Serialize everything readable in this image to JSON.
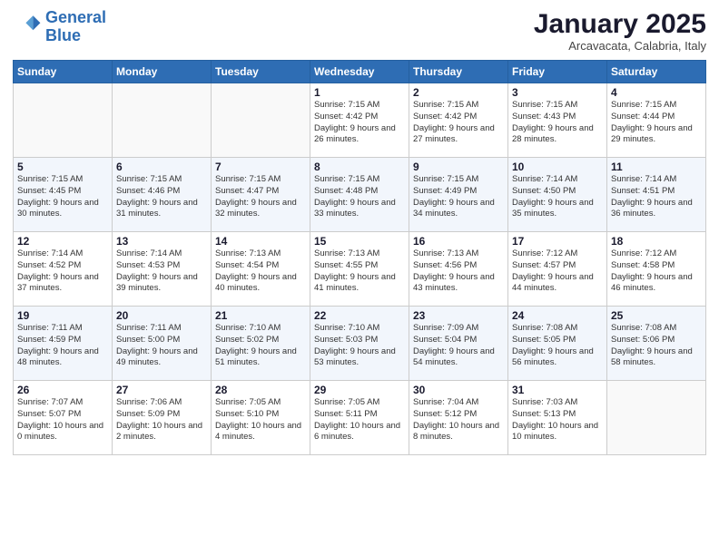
{
  "logo": {
    "line1": "General",
    "line2": "Blue"
  },
  "title": "January 2025",
  "subtitle": "Arcavacata, Calabria, Italy",
  "weekdays": [
    "Sunday",
    "Monday",
    "Tuesday",
    "Wednesday",
    "Thursday",
    "Friday",
    "Saturday"
  ],
  "weeks": [
    [
      {
        "day": "",
        "info": ""
      },
      {
        "day": "",
        "info": ""
      },
      {
        "day": "",
        "info": ""
      },
      {
        "day": "1",
        "info": "Sunrise: 7:15 AM\nSunset: 4:42 PM\nDaylight: 9 hours and 26 minutes."
      },
      {
        "day": "2",
        "info": "Sunrise: 7:15 AM\nSunset: 4:42 PM\nDaylight: 9 hours and 27 minutes."
      },
      {
        "day": "3",
        "info": "Sunrise: 7:15 AM\nSunset: 4:43 PM\nDaylight: 9 hours and 28 minutes."
      },
      {
        "day": "4",
        "info": "Sunrise: 7:15 AM\nSunset: 4:44 PM\nDaylight: 9 hours and 29 minutes."
      }
    ],
    [
      {
        "day": "5",
        "info": "Sunrise: 7:15 AM\nSunset: 4:45 PM\nDaylight: 9 hours and 30 minutes."
      },
      {
        "day": "6",
        "info": "Sunrise: 7:15 AM\nSunset: 4:46 PM\nDaylight: 9 hours and 31 minutes."
      },
      {
        "day": "7",
        "info": "Sunrise: 7:15 AM\nSunset: 4:47 PM\nDaylight: 9 hours and 32 minutes."
      },
      {
        "day": "8",
        "info": "Sunrise: 7:15 AM\nSunset: 4:48 PM\nDaylight: 9 hours and 33 minutes."
      },
      {
        "day": "9",
        "info": "Sunrise: 7:15 AM\nSunset: 4:49 PM\nDaylight: 9 hours and 34 minutes."
      },
      {
        "day": "10",
        "info": "Sunrise: 7:14 AM\nSunset: 4:50 PM\nDaylight: 9 hours and 35 minutes."
      },
      {
        "day": "11",
        "info": "Sunrise: 7:14 AM\nSunset: 4:51 PM\nDaylight: 9 hours and 36 minutes."
      }
    ],
    [
      {
        "day": "12",
        "info": "Sunrise: 7:14 AM\nSunset: 4:52 PM\nDaylight: 9 hours and 37 minutes."
      },
      {
        "day": "13",
        "info": "Sunrise: 7:14 AM\nSunset: 4:53 PM\nDaylight: 9 hours and 39 minutes."
      },
      {
        "day": "14",
        "info": "Sunrise: 7:13 AM\nSunset: 4:54 PM\nDaylight: 9 hours and 40 minutes."
      },
      {
        "day": "15",
        "info": "Sunrise: 7:13 AM\nSunset: 4:55 PM\nDaylight: 9 hours and 41 minutes."
      },
      {
        "day": "16",
        "info": "Sunrise: 7:13 AM\nSunset: 4:56 PM\nDaylight: 9 hours and 43 minutes."
      },
      {
        "day": "17",
        "info": "Sunrise: 7:12 AM\nSunset: 4:57 PM\nDaylight: 9 hours and 44 minutes."
      },
      {
        "day": "18",
        "info": "Sunrise: 7:12 AM\nSunset: 4:58 PM\nDaylight: 9 hours and 46 minutes."
      }
    ],
    [
      {
        "day": "19",
        "info": "Sunrise: 7:11 AM\nSunset: 4:59 PM\nDaylight: 9 hours and 48 minutes."
      },
      {
        "day": "20",
        "info": "Sunrise: 7:11 AM\nSunset: 5:00 PM\nDaylight: 9 hours and 49 minutes."
      },
      {
        "day": "21",
        "info": "Sunrise: 7:10 AM\nSunset: 5:02 PM\nDaylight: 9 hours and 51 minutes."
      },
      {
        "day": "22",
        "info": "Sunrise: 7:10 AM\nSunset: 5:03 PM\nDaylight: 9 hours and 53 minutes."
      },
      {
        "day": "23",
        "info": "Sunrise: 7:09 AM\nSunset: 5:04 PM\nDaylight: 9 hours and 54 minutes."
      },
      {
        "day": "24",
        "info": "Sunrise: 7:08 AM\nSunset: 5:05 PM\nDaylight: 9 hours and 56 minutes."
      },
      {
        "day": "25",
        "info": "Sunrise: 7:08 AM\nSunset: 5:06 PM\nDaylight: 9 hours and 58 minutes."
      }
    ],
    [
      {
        "day": "26",
        "info": "Sunrise: 7:07 AM\nSunset: 5:07 PM\nDaylight: 10 hours and 0 minutes."
      },
      {
        "day": "27",
        "info": "Sunrise: 7:06 AM\nSunset: 5:09 PM\nDaylight: 10 hours and 2 minutes."
      },
      {
        "day": "28",
        "info": "Sunrise: 7:05 AM\nSunset: 5:10 PM\nDaylight: 10 hours and 4 minutes."
      },
      {
        "day": "29",
        "info": "Sunrise: 7:05 AM\nSunset: 5:11 PM\nDaylight: 10 hours and 6 minutes."
      },
      {
        "day": "30",
        "info": "Sunrise: 7:04 AM\nSunset: 5:12 PM\nDaylight: 10 hours and 8 minutes."
      },
      {
        "day": "31",
        "info": "Sunrise: 7:03 AM\nSunset: 5:13 PM\nDaylight: 10 hours and 10 minutes."
      },
      {
        "day": "",
        "info": ""
      }
    ]
  ]
}
